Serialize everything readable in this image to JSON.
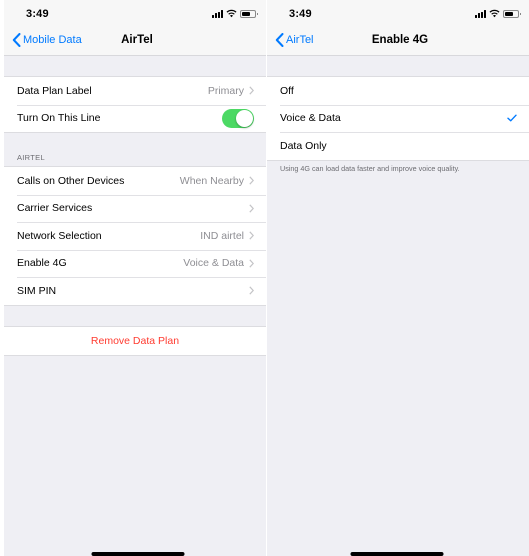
{
  "left": {
    "status": {
      "time": "3:49"
    },
    "nav": {
      "back_label": "Mobile Data",
      "title": "AirTel"
    },
    "group1": [
      {
        "label": "Data Plan Label",
        "value": "Primary"
      },
      {
        "label": "Turn On This Line",
        "toggle": true
      }
    ],
    "section_header": "AIRTEL",
    "group2": [
      {
        "label": "Calls on Other Devices",
        "value": "When Nearby"
      },
      {
        "label": "Carrier Services",
        "value": ""
      },
      {
        "label": "Network Selection",
        "value": "IND airtel"
      },
      {
        "label": "Enable 4G",
        "value": "Voice & Data"
      },
      {
        "label": "SIM PIN",
        "value": ""
      }
    ],
    "remove_label": "Remove Data Plan"
  },
  "right": {
    "status": {
      "time": "3:49"
    },
    "nav": {
      "back_label": "AirTel",
      "title": "Enable 4G"
    },
    "options": [
      {
        "label": "Off",
        "selected": false
      },
      {
        "label": "Voice & Data",
        "selected": true
      },
      {
        "label": "Data Only",
        "selected": false
      }
    ],
    "footer": "Using 4G can load data faster and improve voice quality."
  },
  "colors": {
    "accent": "#007aff",
    "toggle_on": "#4cd964",
    "destructive": "#ff3b30",
    "secondary_text": "#8e8e93",
    "grouped_background": "#efeff4"
  },
  "icons": [
    "chevron-left-icon",
    "chevron-right-icon",
    "checkmark-icon",
    "signal-icon",
    "wifi-icon",
    "battery-icon"
  ]
}
